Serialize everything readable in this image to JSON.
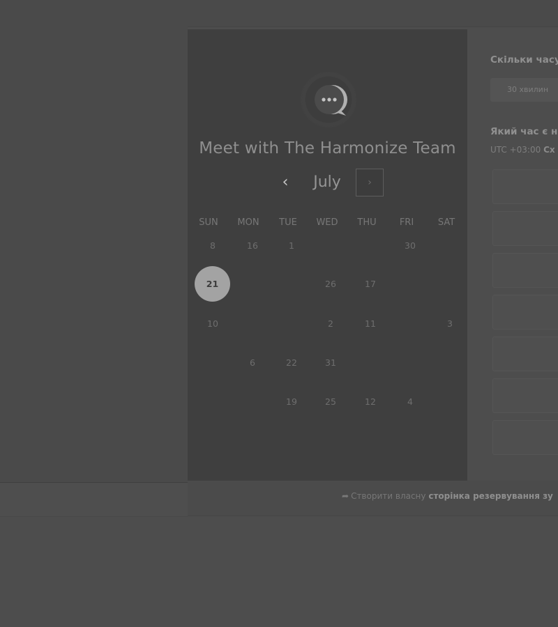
{
  "calendar": {
    "title": "Meet with The Harmonize Team",
    "month": "July",
    "prev_glyph": "‹",
    "next_glyph": "›",
    "weekdays": [
      "SUN",
      "MON",
      "TUE",
      "WED",
      "THU",
      "FRI",
      "SAT"
    ],
    "rows": [
      [
        "8",
        "16",
        "1",
        "",
        "",
        "30",
        ""
      ],
      [
        "21",
        "",
        "",
        "26",
        "17",
        "",
        ""
      ],
      [
        "10",
        "",
        "",
        "2",
        "11",
        "",
        "3"
      ],
      [
        "",
        "6",
        "22",
        "31",
        "",
        "",
        ""
      ],
      [
        "",
        "",
        "19",
        "25",
        "12",
        "4",
        ""
      ]
    ],
    "selected_day": "21"
  },
  "booking": {
    "duration_question": "Скільки часу",
    "duration_option": "30 хвилин",
    "time_question": "Який час є н",
    "timezone_prefix": "UTC +03:00",
    "timezone_suffix": "Сх",
    "slot_count": 7
  },
  "footer": {
    "prefix": "Створити власну",
    "link": "сторінка резервування зу"
  },
  "icons": {
    "logo": "chat-bubble-logo",
    "footer": "cursor-arrow-icon"
  },
  "colors": {
    "overlay_bg": "#4d4d4d",
    "panel_bg": "#3f3f3f",
    "selected_day_bg": "#a3a3a3"
  }
}
